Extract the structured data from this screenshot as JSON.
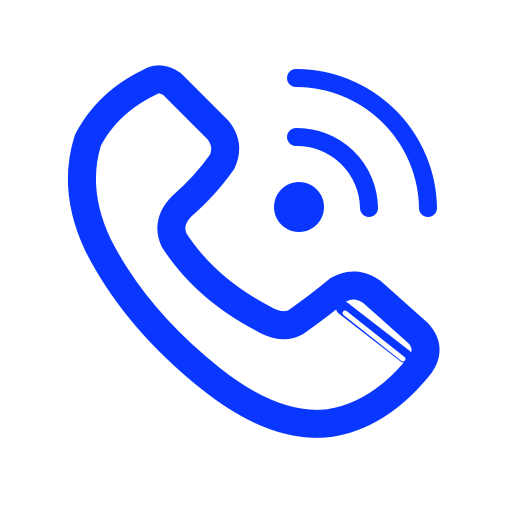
{
  "icon": {
    "name": "phone-call-icon",
    "color": "#0a37ff",
    "background": "#ffffff"
  }
}
